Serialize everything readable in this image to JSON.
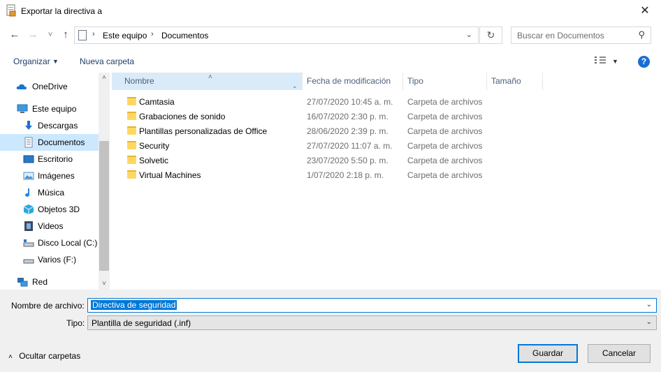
{
  "window": {
    "title": "Exportar la directiva a",
    "close_glyph": "✕"
  },
  "nav": {
    "back_glyph": "←",
    "forward_glyph": "→",
    "recent_glyph": "˅",
    "up_glyph": "↑",
    "breadcrumb": [
      "Este equipo",
      "Documentos"
    ],
    "crumb_sep": "›",
    "address_dropdown_glyph": "⌄",
    "refresh_glyph": "↻",
    "search_placeholder": "Buscar en Documentos",
    "search_glyph": "⚲"
  },
  "toolbar": {
    "organize_label": "Organizar",
    "organize_caret": "▼",
    "new_folder_label": "Nueva carpeta",
    "view_caret": "▼",
    "help_label": "?"
  },
  "sidebar": {
    "items": [
      {
        "label": "OneDrive",
        "icon": "cloud-icon",
        "color": "#1a73d1"
      },
      {
        "label": "Este equipo",
        "icon": "computer-icon",
        "color": "#3c9be0"
      },
      {
        "label": "Descargas",
        "icon": "download-icon",
        "color": "#1e6fd0"
      },
      {
        "label": "Documentos",
        "icon": "document-icon",
        "color": "#7a8aa0",
        "selected": true
      },
      {
        "label": "Escritorio",
        "icon": "desktop-icon",
        "color": "#2b78c8"
      },
      {
        "label": "Imágenes",
        "icon": "pictures-icon",
        "color": "#4a90c8"
      },
      {
        "label": "Música",
        "icon": "music-icon",
        "color": "#1e88e5"
      },
      {
        "label": "Objetos 3D",
        "icon": "cube-icon",
        "color": "#29a8e0"
      },
      {
        "label": "Videos",
        "icon": "film-icon",
        "color": "#3a4a63"
      },
      {
        "label": "Disco Local (C:)",
        "icon": "drive-icon",
        "color": "#5a6470"
      },
      {
        "label": "Varios (F:)",
        "icon": "drive-icon",
        "color": "#5a6470"
      },
      {
        "label": "Red",
        "icon": "network-icon",
        "color": "#2a6fb0"
      }
    ],
    "scroll_up_glyph": "˄",
    "scroll_down_glyph": "˅"
  },
  "list": {
    "columns": [
      "Nombre",
      "Fecha de modificación",
      "Tipo",
      "Tamaño"
    ],
    "sort_glyph": "˄",
    "column_dd_glyph": "⌄",
    "rows": [
      {
        "name": "Camtasia",
        "date": "27/07/2020 10:45 a. m.",
        "type": "Carpeta de archivos"
      },
      {
        "name": "Grabaciones de sonido",
        "date": "16/07/2020 2:30 p. m.",
        "type": "Carpeta de archivos"
      },
      {
        "name": "Plantillas personalizadas de Office",
        "date": "28/06/2020 2:39 p. m.",
        "type": "Carpeta de archivos"
      },
      {
        "name": "Security",
        "date": "27/07/2020 11:07 a. m.",
        "type": "Carpeta de archivos"
      },
      {
        "name": "Solvetic",
        "date": "23/07/2020 5:50 p. m.",
        "type": "Carpeta de archivos"
      },
      {
        "name": "Virtual Machines",
        "date": "1/07/2020 2:18 p. m.",
        "type": "Carpeta de archivos"
      }
    ]
  },
  "form": {
    "filename_label": "Nombre de archivo:",
    "filename_value": "Directiva de seguridad",
    "type_label": "Tipo:",
    "type_value": "Plantilla de seguridad (.inf)",
    "dropdown_glyph": "⌄",
    "hide_folders_glyph": "˄",
    "hide_folders_label": "Ocultar carpetas",
    "save_label": "Guardar",
    "cancel_label": "Cancelar"
  },
  "colors": {
    "accent": "#0078d7",
    "selection": "#cce8ff",
    "folder": "#ffd864"
  }
}
